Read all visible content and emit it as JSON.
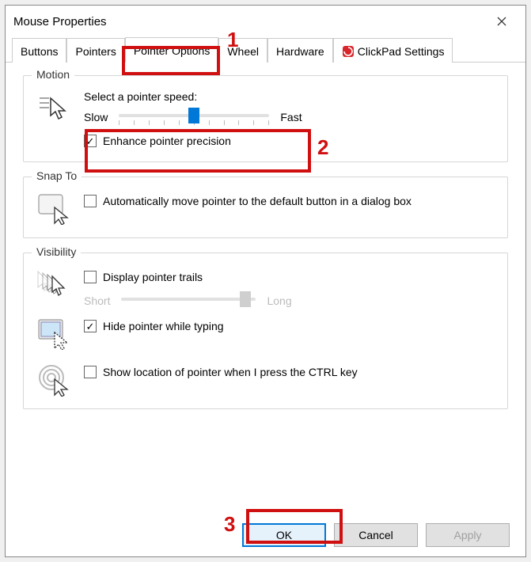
{
  "window": {
    "title": "Mouse Properties"
  },
  "tabs": {
    "items": [
      "Buttons",
      "Pointers",
      "Pointer Options",
      "Wheel",
      "Hardware",
      "ClickPad Settings"
    ],
    "active_index": 2
  },
  "motion": {
    "title": "Motion",
    "speed_label": "Select a pointer speed:",
    "slow": "Slow",
    "fast": "Fast",
    "enhance_label": "Enhance pointer precision",
    "enhance_checked": true,
    "speed_value": 5,
    "speed_min": 0,
    "speed_max": 10
  },
  "snapto": {
    "title": "Snap To",
    "auto_label": "Automatically move pointer to the default button in a dialog box",
    "auto_checked": false
  },
  "visibility": {
    "title": "Visibility",
    "trails_label": "Display pointer trails",
    "trails_checked": false,
    "short": "Short",
    "long": "Long",
    "hide_label": "Hide pointer while typing",
    "hide_checked": true,
    "ctrl_label": "Show location of pointer when I press the CTRL key",
    "ctrl_checked": false
  },
  "buttons": {
    "ok": "OK",
    "cancel": "Cancel",
    "apply": "Apply"
  },
  "annotations": {
    "n1": "1",
    "n2": "2",
    "n3": "3"
  }
}
